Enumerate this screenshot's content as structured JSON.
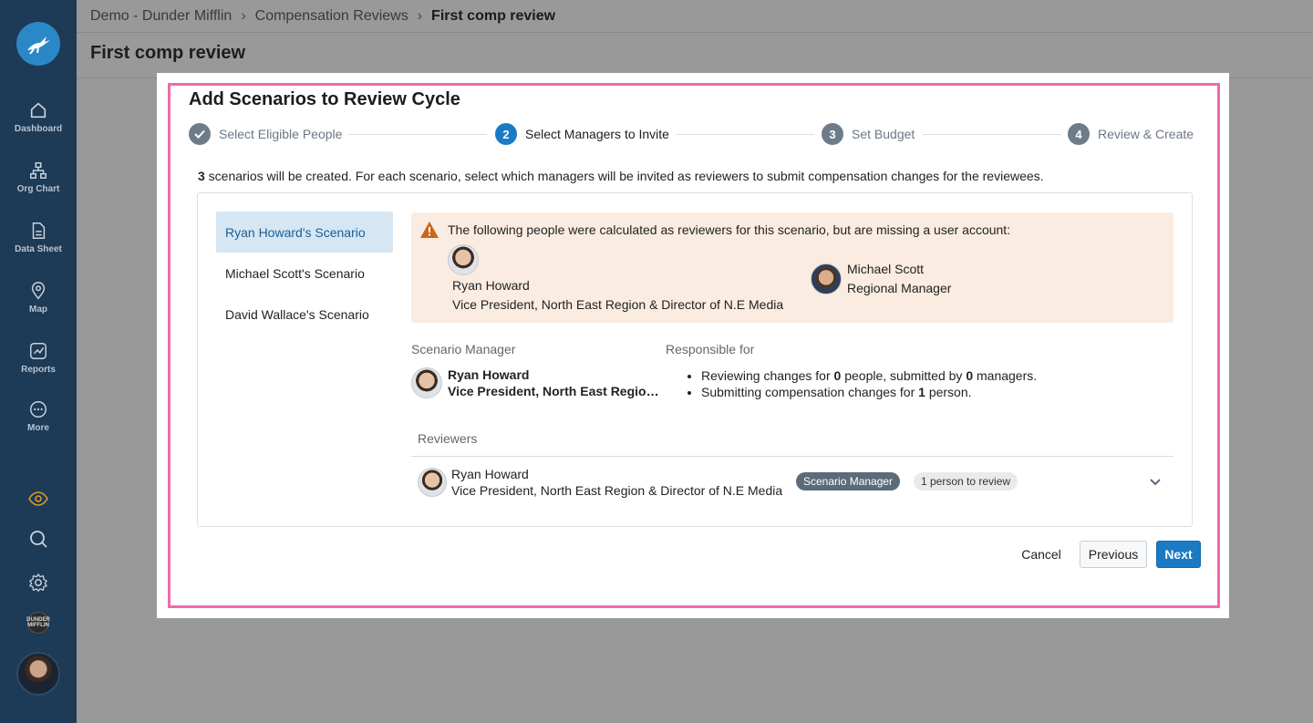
{
  "sidebar": {
    "items": [
      {
        "label": "Dashboard",
        "icon": "home-icon"
      },
      {
        "label": "Org Chart",
        "icon": "org-chart-icon"
      },
      {
        "label": "Data Sheet",
        "icon": "document-icon"
      },
      {
        "label": "Map",
        "icon": "map-pin-icon"
      },
      {
        "label": "Reports",
        "icon": "chart-icon"
      },
      {
        "label": "More",
        "icon": "more-icon"
      }
    ],
    "company_badge": "DUNDER MIFFLIN"
  },
  "breadcrumb": {
    "items": [
      "Demo - Dunder Mifflin",
      "Compensation Reviews",
      "First comp review"
    ]
  },
  "page": {
    "title": "First comp review"
  },
  "modal": {
    "title": "Add Scenarios to Review Cycle",
    "steps": [
      {
        "label": "Select Eligible People",
        "number": "",
        "state": "done"
      },
      {
        "label": "Select Managers to Invite",
        "number": "2",
        "state": "active"
      },
      {
        "label": "Set Budget",
        "number": "3",
        "state": "pending"
      },
      {
        "label": "Review & Create",
        "number": "4",
        "state": "pending"
      }
    ],
    "intro_count": "3",
    "intro_text": " scenarios will be created. For each scenario, select which managers will be invited as reviewers to submit compensation changes for the reviewees.",
    "scenarios": [
      "Ryan Howard's Scenario",
      "Michael Scott's Scenario",
      "David Wallace's Scenario"
    ],
    "warning": {
      "text": "The following people were calculated as reviewers for this scenario, but are missing a user account:",
      "people": [
        {
          "name": "Ryan Howard",
          "title": "Vice President, North East Region & Director of N.E Media"
        },
        {
          "name": "Michael Scott",
          "title": "Regional Manager"
        }
      ]
    },
    "scenario_manager": {
      "label": "Scenario Manager",
      "name": "Ryan Howard",
      "title": "Vice President, North East Regio…"
    },
    "responsible": {
      "label": "Responsible for",
      "line1_pre": "Reviewing changes for ",
      "line1_num1": "0",
      "line1_mid": " people, submitted by ",
      "line1_num2": "0",
      "line1_post": " managers.",
      "line2_pre": "Submitting compensation changes for ",
      "line2_num": "1",
      "line2_post": " person."
    },
    "reviewers": {
      "label": "Reviewers",
      "rows": [
        {
          "name": "Ryan Howard",
          "title": "Vice President, North East Region & Director of N.E Media",
          "badge": "Scenario Manager",
          "count": "1 person to review"
        }
      ]
    },
    "buttons": {
      "cancel": "Cancel",
      "previous": "Previous",
      "next": "Next"
    }
  },
  "colors": {
    "accent": "#1a7ac4",
    "sidebar": "#1d3a57",
    "focus": "#f06aa8",
    "warning_bg": "#faece0"
  }
}
